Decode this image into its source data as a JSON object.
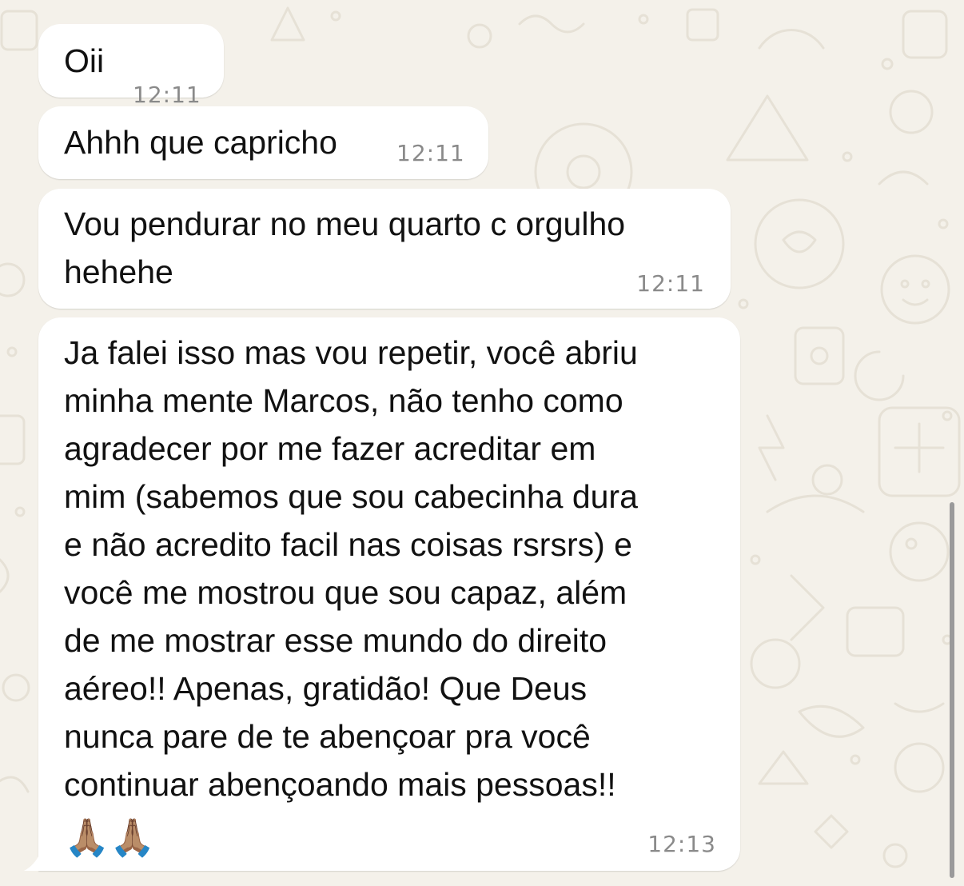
{
  "messages": [
    {
      "text": "Oii",
      "time": "12:11"
    },
    {
      "text": "Ahhh que capricho",
      "time": "12:11"
    },
    {
      "text": "Vou pendurar no meu quarto c orgulho\nhehehe",
      "time": "12:11"
    },
    {
      "text": "Ja falei isso mas vou repetir, você abriu\nminha mente Marcos, não tenho como\nagradecer por me fazer acreditar em\nmim (sabemos que sou cabecinha dura\ne não acredito facil nas coisas rsrsrs) e\nvocê me mostrou que sou capaz, além\nde me mostrar esse mundo do direito\naéreo!! Apenas, gratidão! Que Deus\nnunca pare de te abençoar pra você\ncontinuar abençoando mais pessoas!!",
      "emojis": "🙏🏽🙏🏽",
      "time": "12:13"
    }
  ],
  "colors": {
    "chat_background": "#f4f1ea",
    "bubble": "#ffffff",
    "timestamp": "#8a8a8a"
  }
}
